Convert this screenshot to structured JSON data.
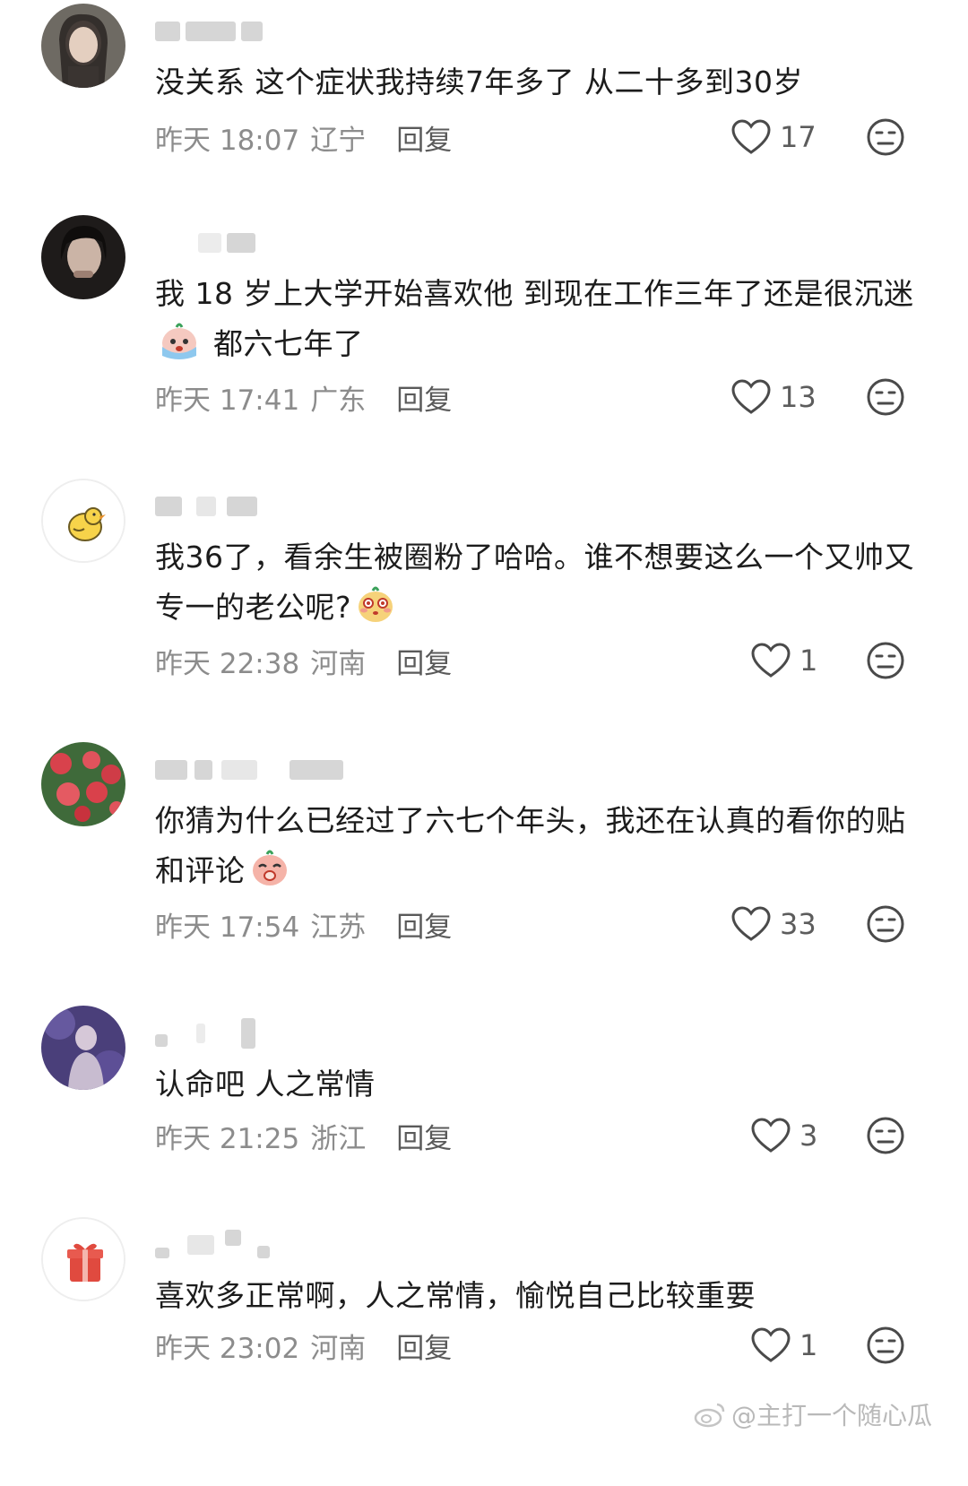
{
  "comments": [
    {
      "text": "没关系  这个症状我持续7年多了  从二十多到30岁",
      "time": "昨天 18:07",
      "region": "辽宁",
      "reply": "回复",
      "likes": "17"
    },
    {
      "text_part1": "我 18 岁上大学开始喜欢他 到现在工作三年了还是很沉迷",
      "text_part2": "  都六七年了",
      "emoji": "crying-emoji",
      "time": "昨天 17:41",
      "region": "广东",
      "reply": "回复",
      "likes": "13"
    },
    {
      "text_part1": "我36了，看余生被圈粉了哈哈。谁不想要这么一个又帅又专一的老公呢?",
      "emoji": "blushing-emoji",
      "time": "昨天 22:38",
      "region": "河南",
      "reply": "回复",
      "likes": "1"
    },
    {
      "text_part1": "你猜为什么已经过了六七个年头，我还在认真的看你的贴和评论",
      "emoji": "giggling-emoji",
      "time": "昨天 17:54",
      "region": "江苏",
      "reply": "回复",
      "likes": "33"
    },
    {
      "text": "认命吧 人之常情",
      "time": "昨天 21:25",
      "region": "浙江",
      "reply": "回复",
      "likes": "3"
    },
    {
      "text": "喜欢多正常啊，人之常情，愉悦自己比较重要",
      "time": "昨天 23:02",
      "region": "河南",
      "reply": "回复",
      "likes": "1"
    }
  ],
  "watermark": "@主打一个随心瓜"
}
